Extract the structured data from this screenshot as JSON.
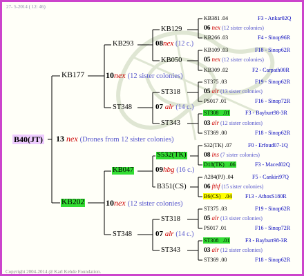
{
  "date": "27-  5-2014 ( 12: 46)",
  "copyright": "Copyright 2004-2014 @ Karl Kehde Foundation.",
  "root": {
    "label": "B40(JT)",
    "count": "13",
    "note": "nex",
    "desc": "(Drones from 12 sister colonies)"
  },
  "gen1": [
    {
      "label": "KB177",
      "count": "10",
      "note": "nex",
      "desc": "(12 sister colonies)"
    },
    {
      "label": "KB202",
      "count": "10",
      "note": "nex",
      "desc": "(12 sister colonies)"
    }
  ],
  "gen2": [
    {
      "label": "KB293",
      "count": "08",
      "note": "nex",
      "desc": "(12 c.)"
    },
    {
      "label": "ST348",
      "count": "07",
      "note": "alr",
      "desc": "(14 c.)"
    },
    {
      "label": "KB047",
      "count": "09",
      "note": "hbg",
      "desc": "(16 c.)"
    },
    {
      "label": "ST348",
      "count": "07",
      "note": "alr",
      "desc": "(14 c.)"
    }
  ],
  "gen3": [
    {
      "label": "KB129",
      "count": "06",
      "note": "nex",
      "desc": "(12 sister colonies)"
    },
    {
      "label": "KB050",
      "count": "05",
      "note": "nex",
      "desc": "(12 sister colonies)"
    },
    {
      "label": "ST318",
      "count": "05",
      "note": "alr",
      "desc": "(13 sister colonies)"
    },
    {
      "label": "ST343",
      "count": "03",
      "note": "alr",
      "desc": "(12 sister colonies)"
    },
    {
      "label": "S532(TK)",
      "count": "08",
      "note": "ins",
      "desc": "(7 sister colonies)"
    },
    {
      "label": "B351(CS)",
      "count": "06",
      "note": "fthf",
      "desc": "(15 sister colonies)"
    },
    {
      "label": "ST318",
      "count": "05",
      "note": "alr",
      "desc": "(13 sister colonies)"
    },
    {
      "label": "ST343",
      "count": "03",
      "note": "alr",
      "desc": "(12 sister colonies)"
    }
  ],
  "gen4": [
    {
      "label": "KB381",
      "val": ".04",
      "tag": "F3 - Ankar02Q"
    },
    {
      "label": "KB266",
      "val": ".03",
      "tag": "F4 - Sinop96R"
    },
    {
      "label": "KB109",
      "val": ".03",
      "tag": "F18 - Sinop62R"
    },
    {
      "label": "KB309",
      "val": ".02",
      "tag": "F2 - Carpath00R"
    },
    {
      "label": "ST375",
      "val": ".03",
      "tag": "F19 - Sinop62R"
    },
    {
      "label": "PS017",
      "val": ".01",
      "tag": "F16 - Sinop72R"
    },
    {
      "label": "ST308",
      "val": ".01",
      "tag": "F3 - Bayburt98-3R"
    },
    {
      "label": "ST369",
      "val": ".00",
      "tag": "F18 - Sinop62R"
    },
    {
      "label": "S32(TK)",
      "val": ".07",
      "tag": "F0 - Erfoud07-1Q"
    },
    {
      "label": "D18(TK)",
      "val": ".06",
      "tag": "F3 - Maced02Q"
    },
    {
      "label": "A284(PJ)",
      "val": ".04",
      "tag": "F5 - Cankiri97Q"
    },
    {
      "label": "B6(CS)",
      "val": ".04",
      "tag": "F13 - AthosS180R"
    },
    {
      "label": "ST375",
      "val": ".03",
      "tag": "F19 - Sinop62R"
    },
    {
      "label": "PS017",
      "val": ".01",
      "tag": "F16 - Sinop72R"
    },
    {
      "label": "ST308",
      "val": ".01",
      "tag": "F3 - Bayburt98-3R"
    },
    {
      "label": "ST369",
      "val": ".00",
      "tag": "F18 - Sinop62R"
    }
  ]
}
